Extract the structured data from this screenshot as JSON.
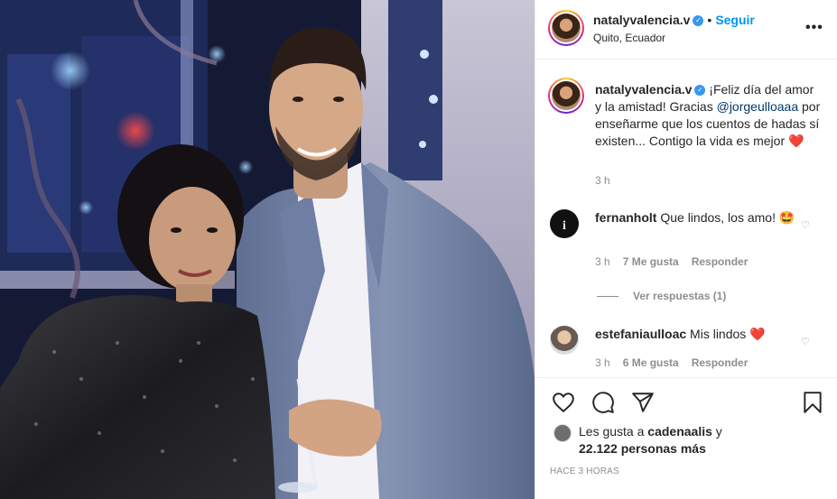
{
  "post": {
    "author": "natalyvalencia.v",
    "follow_label": "Seguir",
    "location": "Quito, Ecuador",
    "more_icon": "more-options-icon",
    "dot": "•"
  },
  "caption": {
    "author": "natalyvalencia.v",
    "text_before": " ¡Feliz día del amor y la amistad! Gracias ",
    "mention": "@jorgeulloaaa",
    "text_after": " por enseñarme que los cuentos de hadas sí existen... Contigo la vida es mejor ",
    "emoji": "❤️",
    "time": "3 h"
  },
  "comments": [
    {
      "author": "fernanholt",
      "text": " Que lindos, los amo! ",
      "emoji": "🤩",
      "time": "3 h",
      "likes": "7 Me gusta",
      "reply_label": "Responder"
    },
    {
      "author": "estefaniaulloac",
      "text": " Mis lindos ",
      "emoji": "❤️",
      "time": "3 h",
      "likes": "6 Me gusta",
      "reply_label": "Responder"
    }
  ],
  "view_replies": "Ver respuestas (1)",
  "actions": {
    "like_icon": "heart-icon",
    "comment_icon": "comment-icon",
    "share_icon": "share-icon",
    "save_icon": "bookmark-icon"
  },
  "likes": {
    "prefix": "Les gusta a ",
    "user": "cadenaalis",
    "mid": " y",
    "count": "22.122 personas más"
  },
  "posted_ago": "HACE 3 HORAS",
  "colors": {
    "link_blue": "#0095f6",
    "mention_blue": "#00376b",
    "meta_gray": "#8e8e8e",
    "heart_red": "#ed4956",
    "verified_blue": "#3897f0"
  }
}
